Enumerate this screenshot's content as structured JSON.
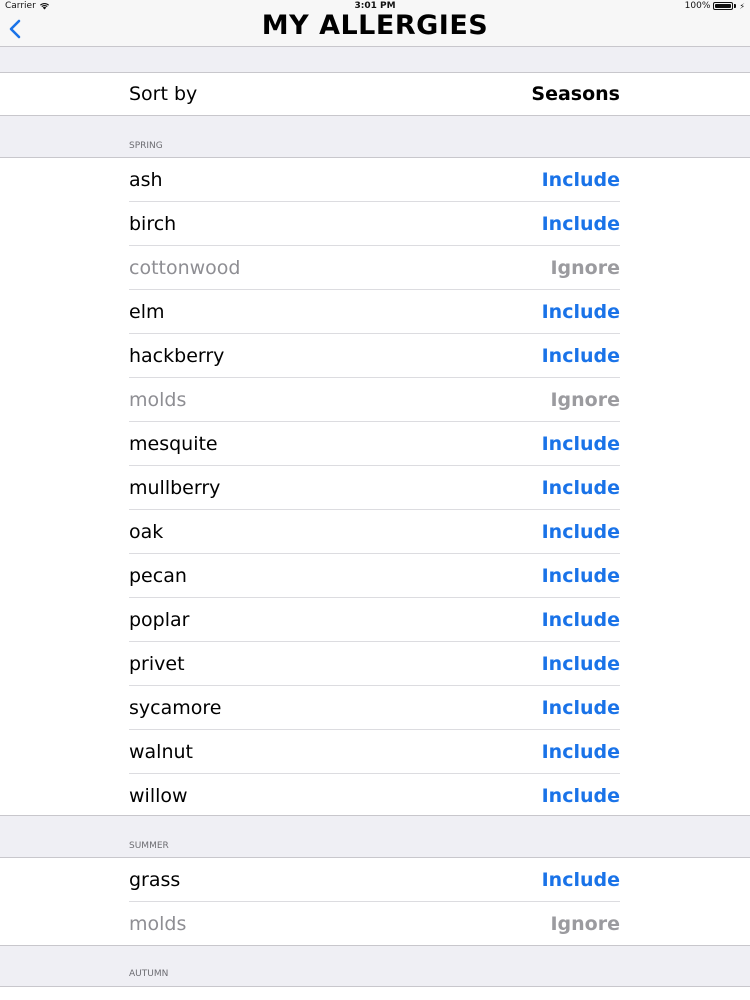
{
  "status_bar": {
    "carrier": "Carrier",
    "time": "3:01 PM",
    "battery": "100%"
  },
  "nav": {
    "title": "MY ALLERGIES"
  },
  "sort": {
    "label": "Sort by",
    "value": "Seasons"
  },
  "sections": [
    {
      "header": "SPRING",
      "items": [
        {
          "name": "ash",
          "action": "Include"
        },
        {
          "name": "birch",
          "action": "Include"
        },
        {
          "name": "cottonwood",
          "action": "Ignore"
        },
        {
          "name": "elm",
          "action": "Include"
        },
        {
          "name": "hackberry",
          "action": "Include"
        },
        {
          "name": "molds",
          "action": "Ignore"
        },
        {
          "name": "mesquite",
          "action": "Include"
        },
        {
          "name": "mullberry",
          "action": "Include"
        },
        {
          "name": "oak",
          "action": "Include"
        },
        {
          "name": "pecan",
          "action": "Include"
        },
        {
          "name": "poplar",
          "action": "Include"
        },
        {
          "name": "privet",
          "action": "Include"
        },
        {
          "name": "sycamore",
          "action": "Include"
        },
        {
          "name": "walnut",
          "action": "Include"
        },
        {
          "name": "willow",
          "action": "Include"
        }
      ]
    },
    {
      "header": "SUMMER",
      "items": [
        {
          "name": "grass",
          "action": "Include"
        },
        {
          "name": "molds",
          "action": "Ignore"
        }
      ]
    },
    {
      "header": "AUTUMN",
      "items": []
    }
  ],
  "colors": {
    "include": "#1a73e8",
    "ignore": "#9b9b9f",
    "background": "#efeff4"
  },
  "icons": {
    "back": "chevron-left-icon",
    "wifi": "wifi-icon",
    "battery": "battery-icon"
  }
}
